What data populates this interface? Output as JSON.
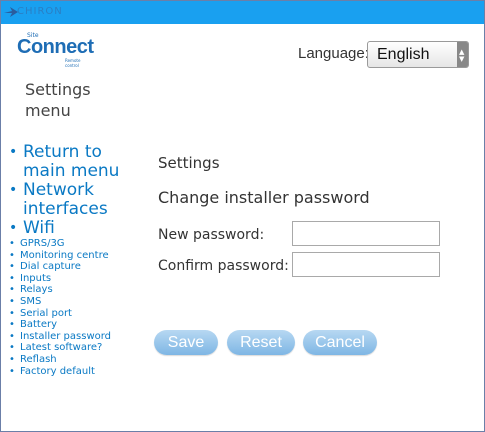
{
  "topbar": {
    "brand": "CHIRON",
    "color": "#19a0f0"
  },
  "header": {
    "logo_site": "Site",
    "logo_name": "Connect",
    "logo_tagline": "Remote control",
    "language_label": "Language:",
    "language_value": "English"
  },
  "sidebar": {
    "heading": "Settings menu",
    "items": [
      {
        "label": "Return to main menu",
        "size": "big"
      },
      {
        "label": "Network interfaces",
        "size": "big"
      },
      {
        "label": "Wifi",
        "size": "big"
      },
      {
        "label": "GPRS/3G",
        "size": "small"
      },
      {
        "label": "Monitoring centre",
        "size": "small"
      },
      {
        "label": "Dial capture",
        "size": "small"
      },
      {
        "label": "Inputs",
        "size": "small"
      },
      {
        "label": "Relays",
        "size": "small"
      },
      {
        "label": "SMS",
        "size": "small"
      },
      {
        "label": "Serial port",
        "size": "small"
      },
      {
        "label": "Battery",
        "size": "small"
      },
      {
        "label": "Installer password",
        "size": "small"
      },
      {
        "label": "Latest software?",
        "size": "small"
      },
      {
        "label": "Reflash",
        "size": "small"
      },
      {
        "label": "Factory default",
        "size": "small"
      }
    ]
  },
  "main": {
    "title": "Settings",
    "section_title": "Change installer password",
    "new_password_label": "New password:",
    "new_password_value": "",
    "confirm_password_label": "Confirm password:",
    "confirm_password_value": "",
    "buttons": {
      "save": "Save",
      "reset": "Reset",
      "cancel": "Cancel"
    }
  },
  "colors": {
    "link": "#0a79c4",
    "button": "#8cc0e8"
  }
}
